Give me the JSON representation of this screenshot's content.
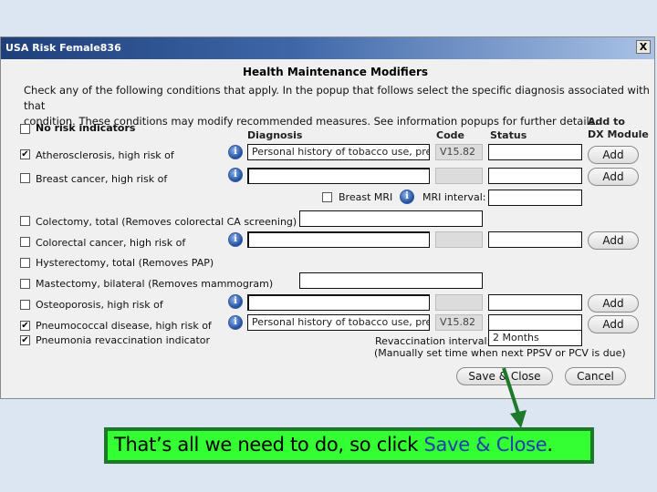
{
  "window": {
    "title": "USA Risk Female836",
    "close_label": "X",
    "heading": "Health Maintenance Modifiers",
    "intro_line1": "Check any of the following conditions that apply.  In the popup that follows select the specific diagnosis associated with that",
    "intro_line2": "condition.  These conditions may modify recommended measures.  See information popups for further details."
  },
  "columns": {
    "diagnosis": "Diagnosis",
    "code": "Code",
    "status": "Status",
    "add_to_line1": "Add to",
    "add_to_line2": "DX Module"
  },
  "conditions": [
    {
      "label": "No risk indicators",
      "checked": false,
      "mark": ""
    },
    {
      "label": "Atherosclerosis, high risk of",
      "checked": true,
      "mark": "✔",
      "diagnosis": "Personal history of tobacco use, pres",
      "code": "V15.82",
      "status": "",
      "add_label": "Add"
    },
    {
      "label": "Breast cancer, high risk of",
      "checked": false,
      "mark": "",
      "diagnosis": "",
      "code": "",
      "status": "",
      "add_label": "Add"
    },
    {
      "label": "Colectomy, total (Removes colorectal CA screening)",
      "checked": false,
      "mark": "",
      "value": ""
    },
    {
      "label": "Colorectal cancer, high risk of",
      "checked": false,
      "mark": "",
      "diagnosis": "",
      "code": "",
      "status": "",
      "add_label": "Add"
    },
    {
      "label": "Hysterectomy, total (Removes PAP)",
      "checked": false,
      "mark": ""
    },
    {
      "label": "Mastectomy, bilateral (Removes mammogram)",
      "checked": false,
      "mark": "",
      "value": ""
    },
    {
      "label": "Osteoporosis, high risk of",
      "checked": false,
      "mark": "",
      "diagnosis": "",
      "code": "",
      "status": "",
      "add_label": "Add"
    },
    {
      "label": "Pneumococcal disease, high risk of",
      "checked": true,
      "mark": "✔",
      "diagnosis": "Personal history of tobacco use, pres",
      "code": "V15.82",
      "status": "",
      "add_label": "Add"
    },
    {
      "label": "Pneumonia revaccination indicator",
      "checked": true,
      "mark": "✔"
    }
  ],
  "breast_mri": {
    "label": "Breast MRI",
    "checked": false,
    "mark": "",
    "interval_label": "MRI interval:",
    "interval_value": ""
  },
  "revaccination": {
    "label": "Revaccination interval:",
    "value": "2 Months",
    "note": "(Manually set time when next PPSV or PCV is due)"
  },
  "footer": {
    "save_label": "Save & Close",
    "cancel_label": "Cancel"
  },
  "annotation": {
    "text": "That’s all we need to do, so click ",
    "highlight": "Save & Close",
    "end": ".",
    "box_color": "#33ff33",
    "border_color": "#1c7a2a",
    "arrow_color": "#1c7a2a"
  }
}
